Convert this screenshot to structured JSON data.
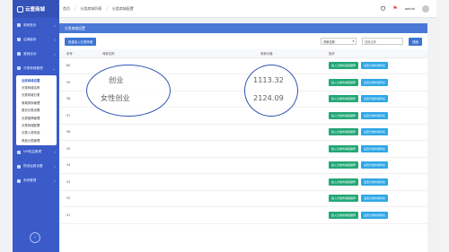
{
  "logo": {
    "text": "云壹商城"
  },
  "sidebar": {
    "items": [
      {
        "label": "商家首页"
      },
      {
        "label": "店铺装修"
      },
      {
        "label": "营销活动"
      },
      {
        "label": "分类商城管理"
      }
    ],
    "sub_items": [
      {
        "label": "全部商城设置"
      },
      {
        "label": "分类商城名称"
      },
      {
        "label": "分类商城分类"
      },
      {
        "label": "商城排序管理"
      },
      {
        "label": "首页分类设置"
      },
      {
        "label": "分类推荐管理"
      },
      {
        "label": "分类商城配置"
      },
      {
        "label": "分类入驻商品"
      },
      {
        "label": "商品分类管理"
      }
    ],
    "bottom_items": [
      {
        "label": "VIP权益管理"
      },
      {
        "label": "物流运费设置"
      },
      {
        "label": "系统管理"
      }
    ]
  },
  "header": {
    "breadcrumb": [
      "首页",
      "分类商城列表",
      "分类商城配置"
    ],
    "tab": "分类商城设置",
    "user": "admin"
  },
  "panel": {
    "title": "分类商城设置"
  },
  "toolbar": {
    "add_label": "批量加入分类商城",
    "select_value": "商家名称",
    "search_placeholder": "搜索名称",
    "search_label": "搜索"
  },
  "table": {
    "headers": [
      "序号",
      "商家名称",
      "商家价格",
      "操作"
    ],
    "rows": [
      {
        "idx": "60",
        "name": "",
        "price": ""
      },
      {
        "idx": "59",
        "name": "",
        "price": ""
      },
      {
        "idx": "58",
        "name": "",
        "price": ""
      },
      {
        "idx": "57",
        "name": "",
        "price": ""
      },
      {
        "idx": "56",
        "name": "",
        "price": ""
      },
      {
        "idx": "55",
        "name": "",
        "price": ""
      },
      {
        "idx": "54",
        "name": "",
        "price": ""
      },
      {
        "idx": "53",
        "name": "",
        "price": ""
      },
      {
        "idx": "52",
        "name": "",
        "price": ""
      },
      {
        "idx": "51",
        "name": "",
        "price": ""
      }
    ],
    "action_add": "加入分类商城首推荐",
    "action_cancel": "设置分类商城列表"
  },
  "highlight": {
    "left": [
      "创业",
      "女性创业"
    ],
    "right": [
      "1113.32",
      "2124.09"
    ]
  }
}
